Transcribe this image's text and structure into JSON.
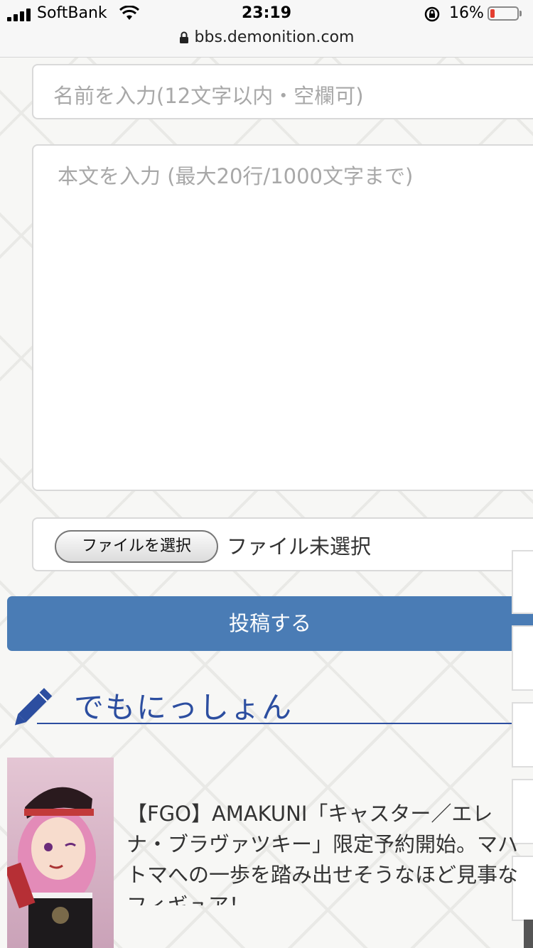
{
  "status_bar": {
    "carrier": "SoftBank",
    "time": "23:19",
    "battery_percent": "16%",
    "battery_level": 0.16,
    "battery_color": "#e43d2f"
  },
  "browser": {
    "url": "bbs.demonition.com"
  },
  "form": {
    "name_placeholder": "名前を入力(12文字以内・空欄可)",
    "body_placeholder": "本文を入力 (最大20行/1000文字まで)",
    "file_button_label": "ファイルを選択",
    "file_status": "ファイル未選択",
    "submit_label": "投稿する",
    "submit_color": "#4a7cb5"
  },
  "section": {
    "title": "でもにっしょん",
    "accent_color": "#2c4ea0",
    "icon": "pencil-icon"
  },
  "article": {
    "title": "【FGO】AMAKUNI「キャスター／エレナ・ブラヴァツキー」限定予約開始。マハトマへの一歩を踏み出せそうなほど見事なフィギュア！"
  }
}
